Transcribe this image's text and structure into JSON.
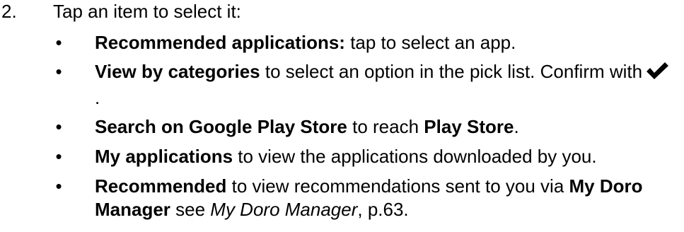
{
  "step": {
    "number": "2.",
    "title": "Tap an item to select it:"
  },
  "bullets": [
    {
      "bold": "Recommended applications:",
      "text": " tap to select an app."
    },
    {
      "bold": "View by categories",
      "text": " to select an option in the pick list. Confirm with",
      "icon": "check-icon",
      "after_icon": "."
    },
    {
      "bold": "Search on Google Play Store",
      "text": " to reach ",
      "bold2": "Play Store",
      "text2": "."
    },
    {
      "bold": "My applications",
      "text": " to view the applications downloaded by you."
    },
    {
      "bold": "Recommended",
      "text": " to view recommendations sent to you via ",
      "bold2": "My Doro Manager",
      "text2": " see ",
      "italic": "My Doro Manager",
      "text3": ", p.63."
    }
  ]
}
